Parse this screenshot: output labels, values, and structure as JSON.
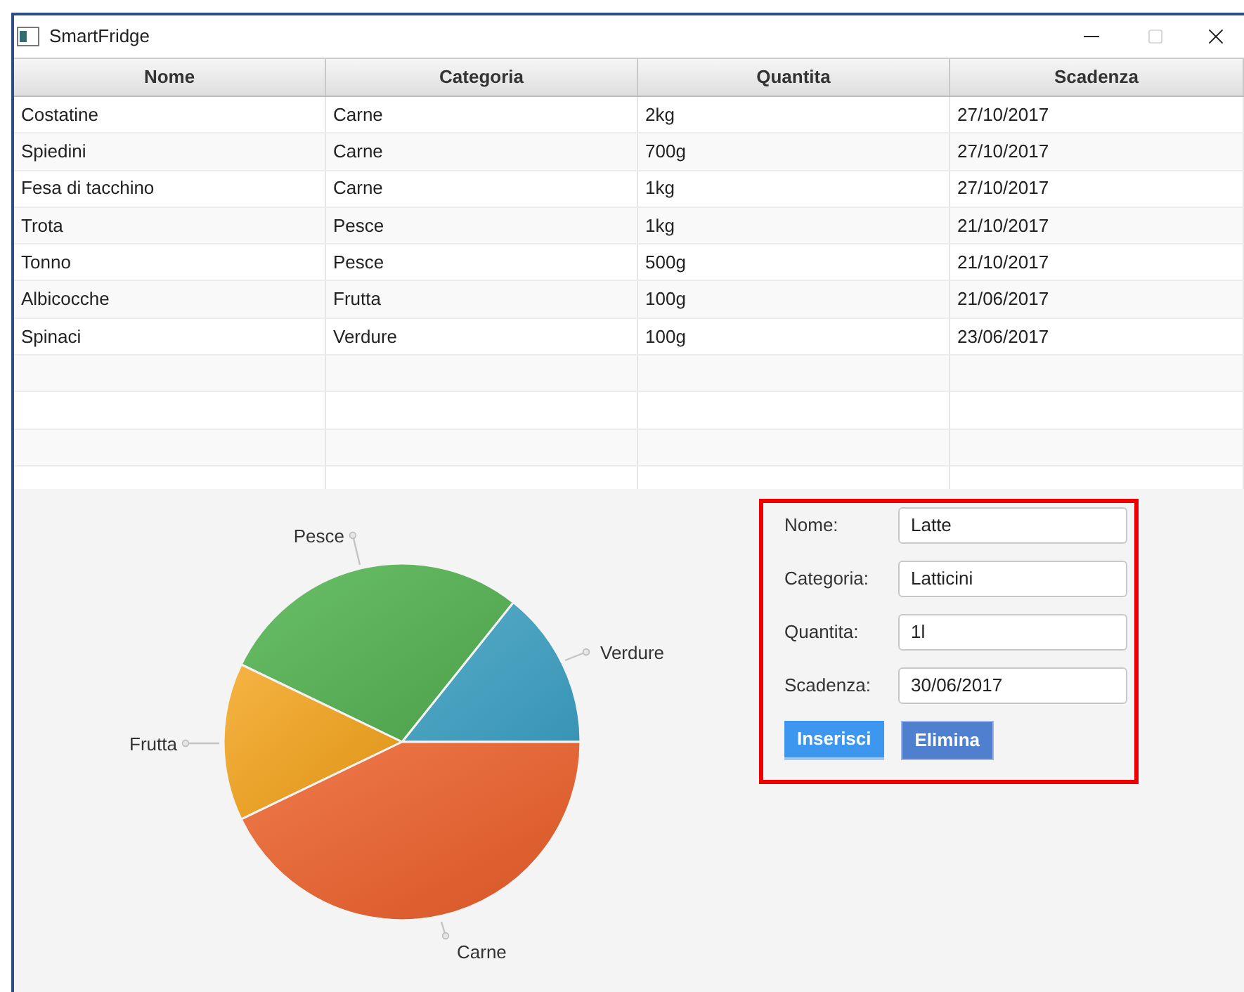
{
  "window": {
    "title": "SmartFridge"
  },
  "table": {
    "columns": [
      "Nome",
      "Categoria",
      "Quantita",
      "Scadenza"
    ],
    "rows": [
      [
        "Costatine",
        "Carne",
        "2kg",
        "27/10/2017"
      ],
      [
        "Spiedini",
        "Carne",
        "700g",
        "27/10/2017"
      ],
      [
        "Fesa di tacchino",
        "Carne",
        "1kg",
        "27/10/2017"
      ],
      [
        "Trota",
        "Pesce",
        "1kg",
        "21/10/2017"
      ],
      [
        "Tonno",
        "Pesce",
        "500g",
        "21/10/2017"
      ],
      [
        "Albicocche",
        "Frutta",
        "100g",
        "21/06/2017"
      ],
      [
        "Spinaci",
        "Verdure",
        "100g",
        "23/06/2017"
      ]
    ]
  },
  "pie": {
    "labels": [
      "Verdure",
      "Pesce",
      "Frutta",
      "Carne"
    ]
  },
  "form": {
    "highlighted": true,
    "fields": [
      {
        "label": "Nome:",
        "value": "Latte"
      },
      {
        "label": "Categoria:",
        "value": "Latticini"
      },
      {
        "label": "Quantita:",
        "value": "1l"
      },
      {
        "label": "Scadenza:",
        "value": "30/06/2017"
      }
    ],
    "buttons": [
      {
        "label": "Inserisci",
        "default": true
      },
      {
        "label": "Elimina",
        "default": false
      }
    ]
  }
}
